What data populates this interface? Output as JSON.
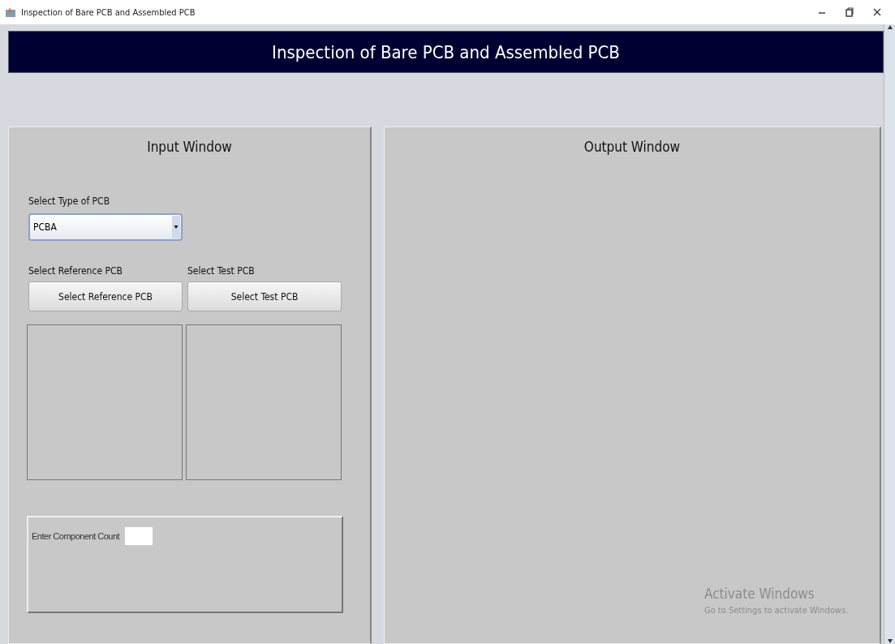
{
  "window": {
    "title": "Inspection of Bare PCB and Assembled PCB"
  },
  "banner": {
    "title": "Inspection of Bare PCB and Assembled PCB"
  },
  "input_panel": {
    "title": "Input Window",
    "type_label": "Select Type of PCB",
    "type_value": "PCBA",
    "reference_label": "Select Reference PCB",
    "reference_button": "Select Reference PCB",
    "test_label": "Select Test PCB",
    "test_button": "Select Test PCB",
    "component_count_label": "Enter Component Count"
  },
  "output_panel": {
    "title": "Output Window"
  },
  "activation_notice": {
    "title": "Activate Windows",
    "subtitle": "Go to Settings to activate Windows."
  }
}
